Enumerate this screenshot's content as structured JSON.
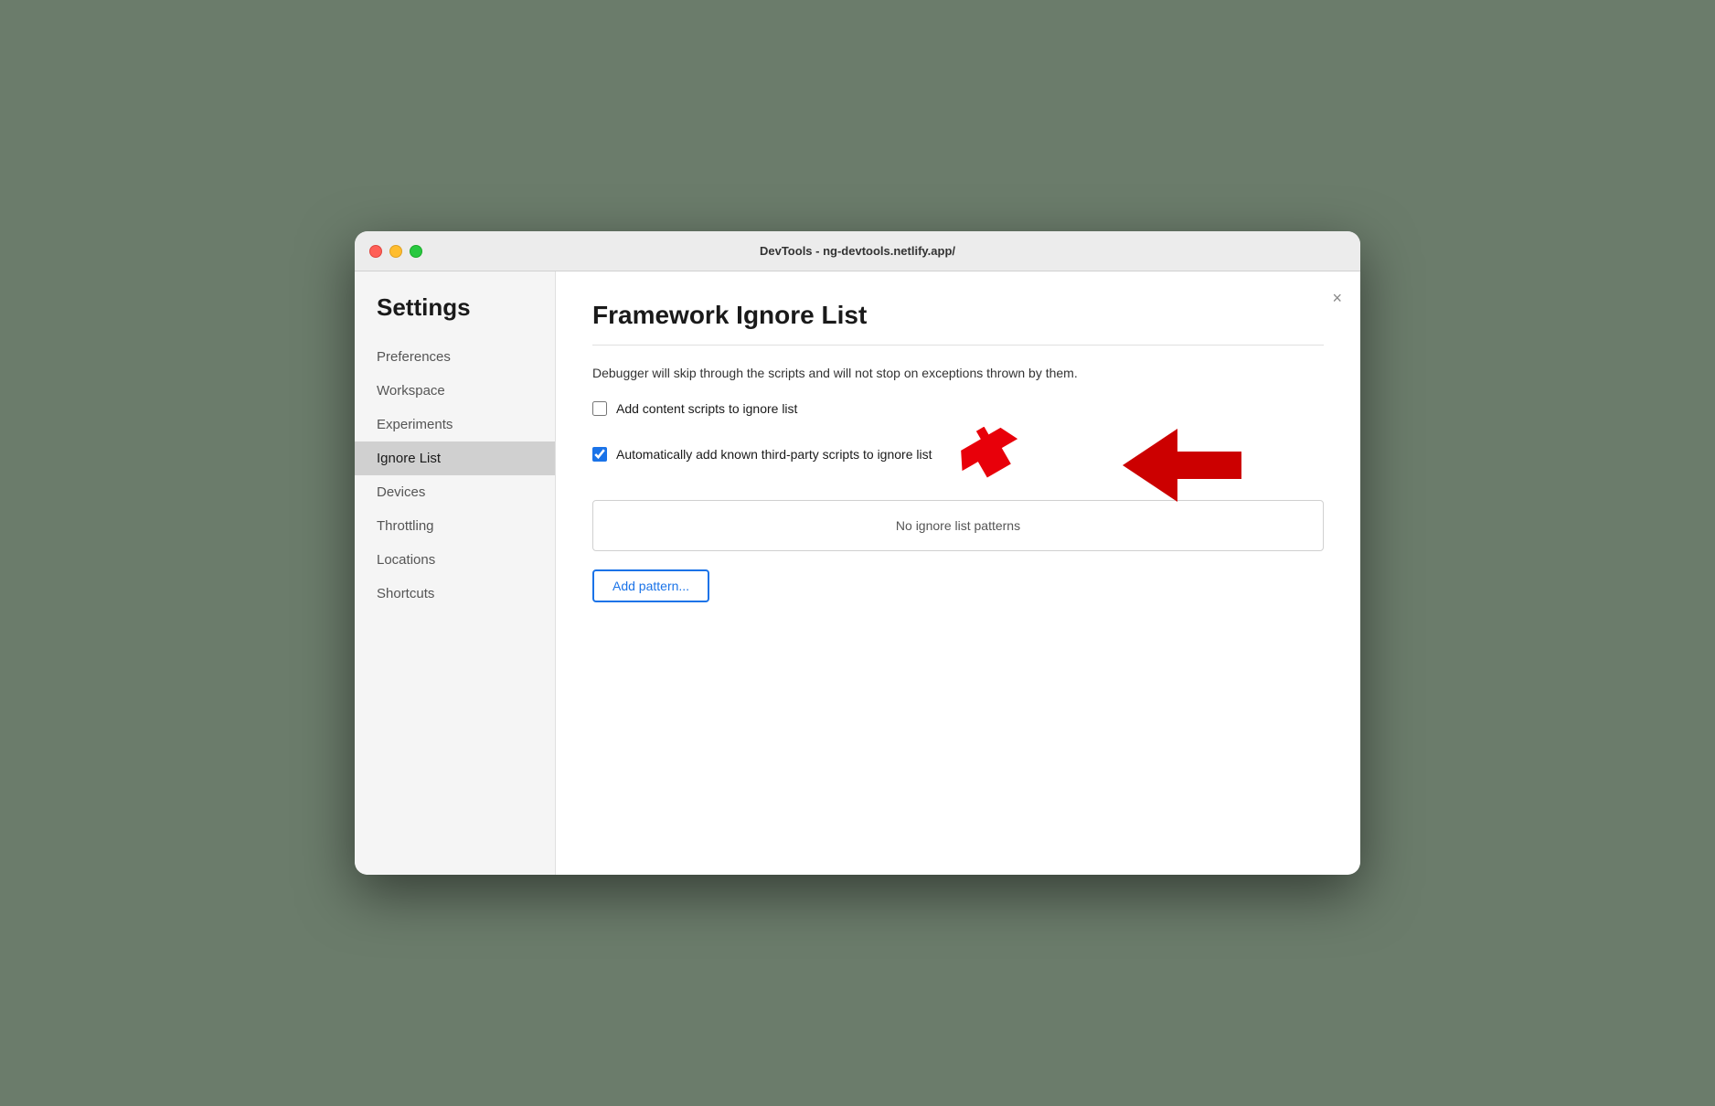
{
  "titlebar": {
    "title": "DevTools - ng-devtools.netlify.app/"
  },
  "sidebar": {
    "heading": "Settings",
    "items": [
      {
        "id": "preferences",
        "label": "Preferences",
        "active": false
      },
      {
        "id": "workspace",
        "label": "Workspace",
        "active": false
      },
      {
        "id": "experiments",
        "label": "Experiments",
        "active": false
      },
      {
        "id": "ignore-list",
        "label": "Ignore List",
        "active": true
      },
      {
        "id": "devices",
        "label": "Devices",
        "active": false
      },
      {
        "id": "throttling",
        "label": "Throttling",
        "active": false
      },
      {
        "id": "locations",
        "label": "Locations",
        "active": false
      },
      {
        "id": "shortcuts",
        "label": "Shortcuts",
        "active": false
      }
    ]
  },
  "main": {
    "title": "Framework Ignore List",
    "description": "Debugger will skip through the scripts and will not stop on exceptions thrown by them.",
    "checkbox1": {
      "label": "Add content scripts to ignore list",
      "checked": false
    },
    "checkbox2": {
      "label": "Automatically add known third-party scripts to ignore list",
      "checked": true
    },
    "ignore_list_empty_text": "No ignore list patterns",
    "add_pattern_button": "Add pattern...",
    "close_button": "×"
  }
}
